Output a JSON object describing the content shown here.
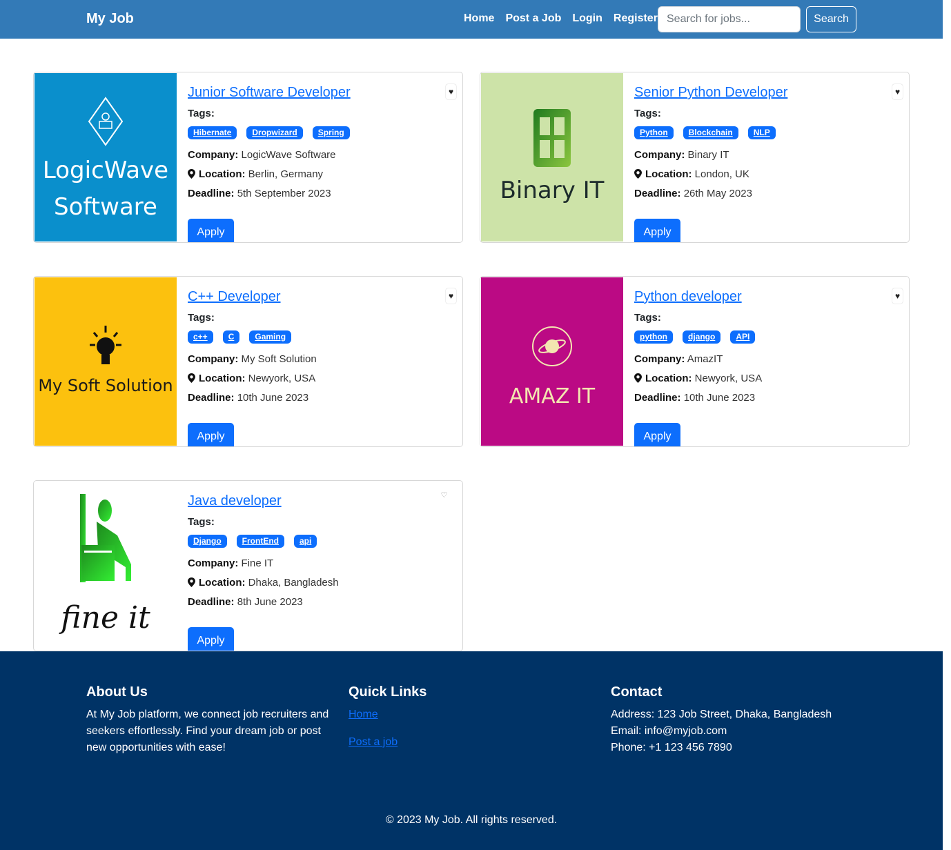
{
  "navbar": {
    "brand": "My Job",
    "links": [
      "Home",
      "Post a Job",
      "Login",
      "Register"
    ],
    "search_placeholder": "Search for jobs...",
    "search_button": "Search"
  },
  "labels": {
    "tags": "Tags:",
    "company": "Company:",
    "location": "Location:",
    "deadline": "Deadline:",
    "apply": "Apply"
  },
  "jobs": [
    {
      "title": "Junior Software Developer",
      "tags": [
        "Hibernate",
        "Dropwizard",
        "Spring"
      ],
      "company": "LogicWave Software",
      "location": "Berlin, Germany",
      "deadline": "5th September 2023",
      "logo_text": [
        "LogicWave",
        "Software"
      ],
      "logo_bg": "#0a8fcc",
      "favorited": true
    },
    {
      "title": "Senior Python Developer",
      "tags": [
        "Python",
        "Blockchain",
        "NLP"
      ],
      "company": "Binary IT",
      "location": "London, UK",
      "deadline": "26th May 2023",
      "logo_text": [
        "Binary IT"
      ],
      "logo_bg": "#cde3a8",
      "favorited": true
    },
    {
      "title": "C++ Developer",
      "tags": [
        "c++",
        "C",
        "Gaming"
      ],
      "company": "My Soft Solution",
      "location": "Newyork, USA",
      "deadline": "10th June 2023",
      "logo_text": [
        "My Soft Solution"
      ],
      "logo_bg": "#fcc10e",
      "favorited": true
    },
    {
      "title": "Python developer",
      "tags": [
        "python",
        "django",
        "API"
      ],
      "company": "AmazIT",
      "location": "Newyork, USA",
      "deadline": "10th June 2023",
      "logo_text": [
        "AMAZ IT"
      ],
      "logo_bg": "#bb0a84",
      "favorited": true
    },
    {
      "title": "Java developer",
      "tags": [
        "Django",
        "FrontEnd",
        "api"
      ],
      "company": "Fine IT",
      "location": "Dhaka, Bangladesh",
      "deadline": "8th June 2023",
      "logo_text": [
        "fine it"
      ],
      "logo_bg": "#ffffff",
      "favorited": false
    }
  ],
  "footer": {
    "about_title": "About Us",
    "about_text": "At My Job platform, we connect job recruiters and seekers effortlessly. Find your dream job or post new opportunities with ease!",
    "links_title": "Quick Links",
    "links": [
      "Home",
      "Post a job"
    ],
    "contact_title": "Contact",
    "address": "Address: 123 Job Street, Dhaka, Bangladesh",
    "email": "Email: info@myjob.com",
    "phone": "Phone: +1 123 456 7890",
    "copyright": "© 2023 My Job. All rights reserved."
  },
  "colors": {
    "navbar": "#337ab7",
    "primary": "#0d6efd",
    "footer": "#003366"
  }
}
